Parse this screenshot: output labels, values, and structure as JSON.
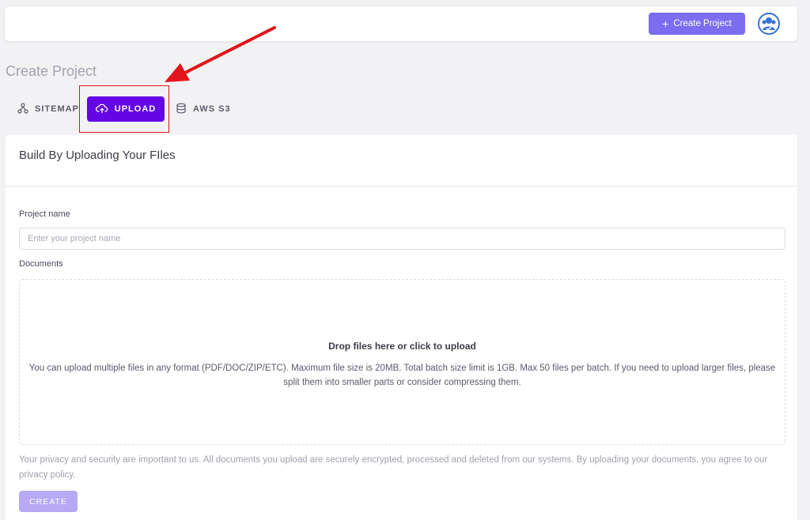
{
  "header": {
    "create_project_label": "Create Project",
    "create_project_icon": "plus-icon",
    "avatar_icon": "user-avatar-icon"
  },
  "page": {
    "title": "Create Project"
  },
  "tabs": [
    {
      "label": "SITEMAP",
      "icon": "sitemap-icon",
      "active": false
    },
    {
      "label": "UPLOAD",
      "icon": "cloud-upload-icon",
      "active": true
    },
    {
      "label": "AWS S3",
      "icon": "database-icon",
      "active": false
    }
  ],
  "form": {
    "card_title": "Build By Uploading Your FIles",
    "project_name_label": "Project name",
    "project_name_placeholder": "Enter your project name",
    "project_name_value": "",
    "documents_label": "Documents",
    "dropzone_title": "Drop files here or click to upload",
    "dropzone_description": "You can upload multiple files in any format (PDF/DOC/ZIP/ETC). Maximum file size is 20MB. Total batch size limit is 1GB. Max 50 files per batch. If you need to upload larger files, please split them into smaller parts or consider compressing them.",
    "privacy_text": "Your privacy and security are important to us. All documents you upload are securely encrypted, processed and deleted from our systems. By uploading your documents, you agree to our privacy policy.",
    "create_label": "CREATE"
  },
  "colors": {
    "accent": "#6405e6",
    "header_button": "#7b6cf0",
    "create_button_disabled": "#b7a9f4",
    "annotation_red": "#e0141a"
  }
}
